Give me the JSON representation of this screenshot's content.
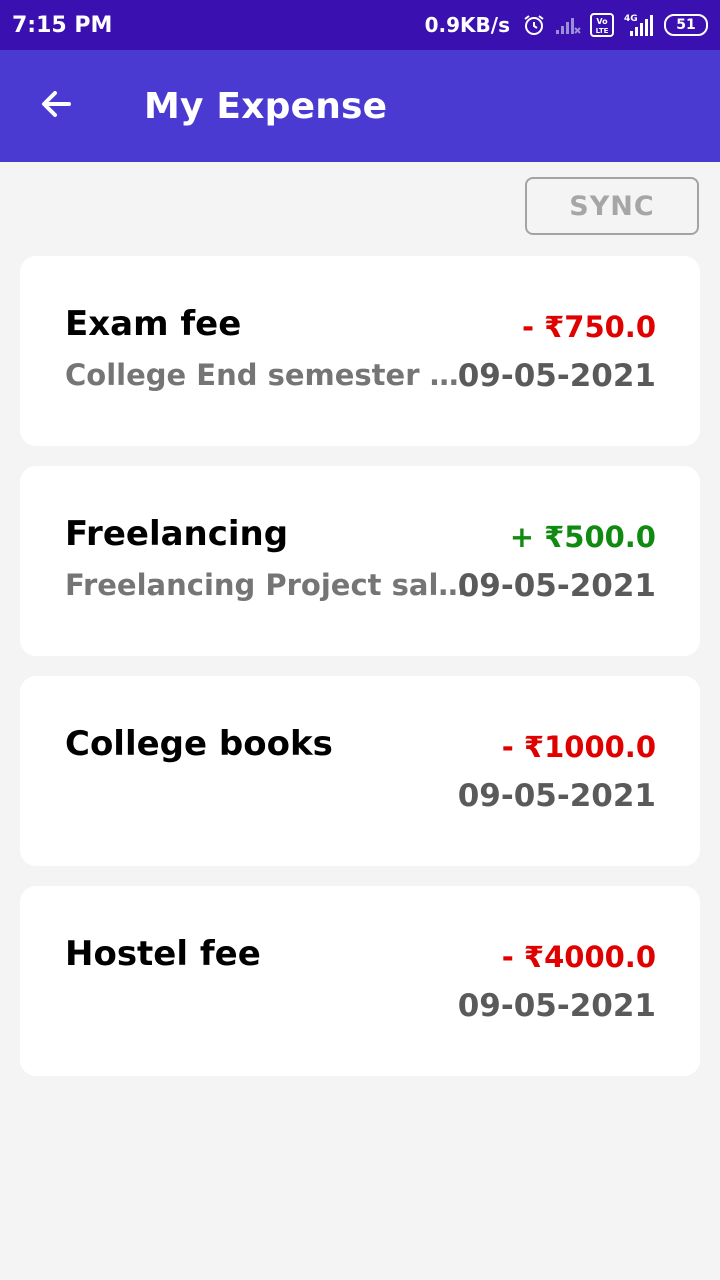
{
  "status_bar": {
    "time": "7:15 PM",
    "speed": "0.9KB/s",
    "battery": "51",
    "icons": [
      "alarm-icon",
      "signal-icon",
      "volte-icon",
      "4g-icon",
      "signal-icon",
      "battery-icon"
    ]
  },
  "app_bar": {
    "back_icon": "arrow-back-icon",
    "title": "My Expense"
  },
  "sync_button": {
    "label": "SYNC"
  },
  "colors": {
    "status_bar": "#3a10b0",
    "app_bar": "#4a3ad1",
    "expense": "#e00000",
    "income": "#118a11"
  },
  "transactions": [
    {
      "title": "Exam fee",
      "description": "College End semester exam fee",
      "amount": "- ₹750.0",
      "type": "expense",
      "date": "09-05-2021"
    },
    {
      "title": "Freelancing",
      "description": "Freelancing Project salary",
      "amount": "+ ₹500.0",
      "type": "income",
      "date": "09-05-2021"
    },
    {
      "title": "College books",
      "description": "",
      "amount": "- ₹1000.0",
      "type": "expense",
      "date": "09-05-2021"
    },
    {
      "title": "Hostel fee",
      "description": "",
      "amount": "- ₹4000.0",
      "type": "expense",
      "date": "09-05-2021"
    }
  ]
}
